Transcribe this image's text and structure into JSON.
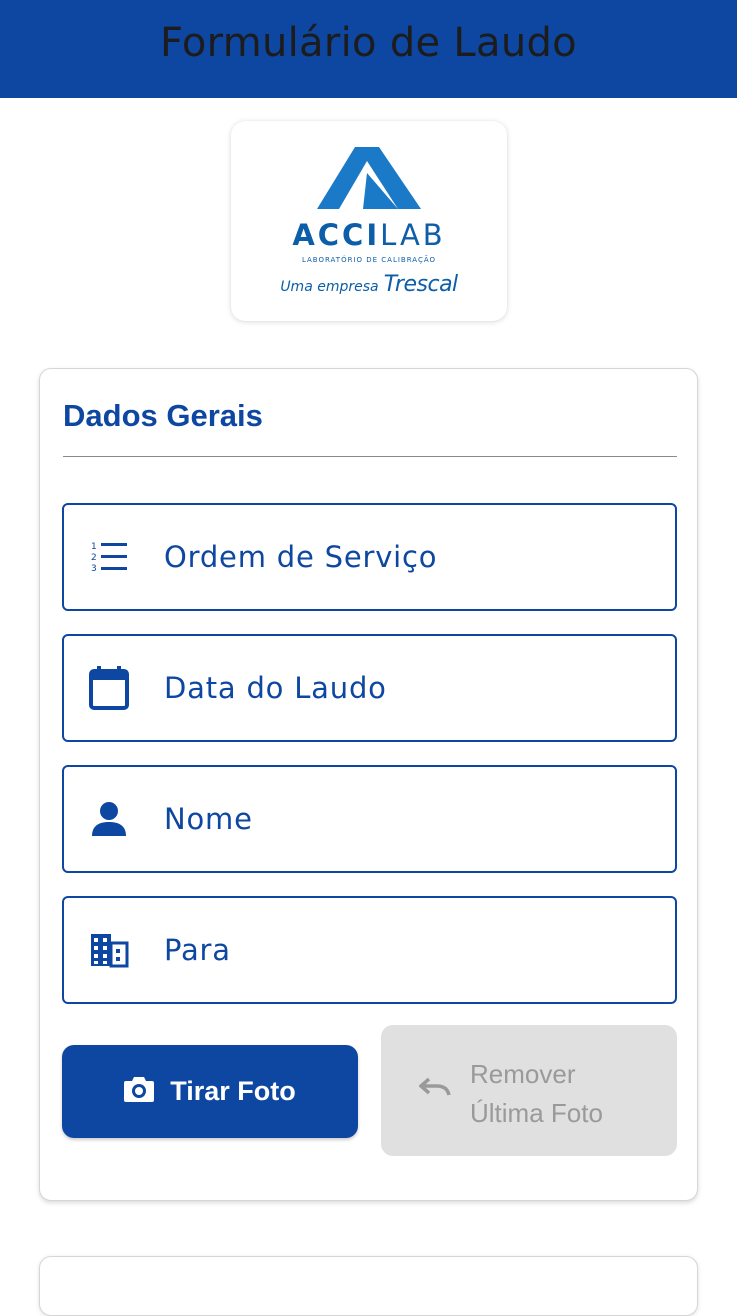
{
  "appbar": {
    "title": "Formulário de Laudo",
    "color": "#0d47a1"
  },
  "logo": {
    "name_bold": "ACCI",
    "name_light": "LAB",
    "subtitle": "LABORATÓRIO DE CALIBRAÇÃO",
    "tagline_prefix": "Uma empresa",
    "tagline_brand": "Trescal"
  },
  "section": {
    "title": "Dados Gerais"
  },
  "fields": [
    {
      "placeholder": "Ordem de Serviço",
      "icon": "numbered-list-icon"
    },
    {
      "placeholder": "Data do Laudo",
      "icon": "calendar-icon"
    },
    {
      "placeholder": "Nome",
      "icon": "person-icon"
    },
    {
      "placeholder": "Para",
      "icon": "building-icon"
    }
  ],
  "actions": {
    "take_photo": {
      "label": "Tirar Foto",
      "icon": "camera-icon"
    },
    "remove_photo": {
      "line1": "Remover",
      "line2": "Última Foto",
      "icon": "undo-icon",
      "disabled": true
    }
  }
}
